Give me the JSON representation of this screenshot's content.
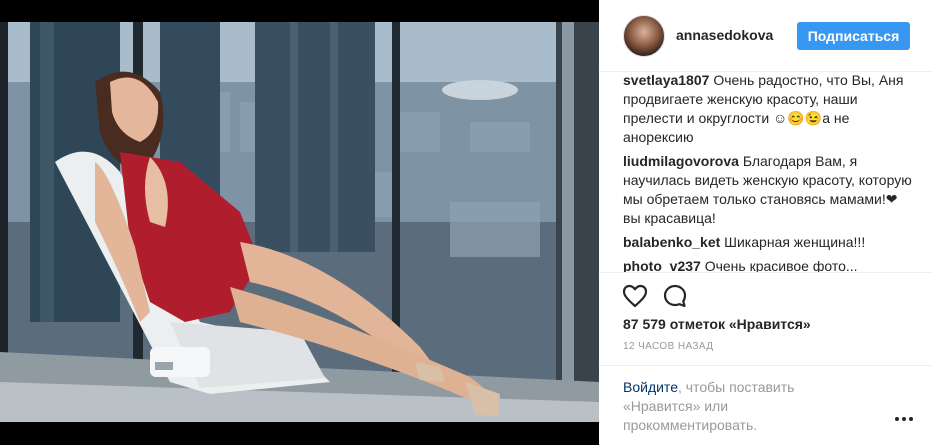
{
  "post": {
    "username": "annasedokova",
    "follow_label": "Подписаться",
    "likes_text": "87 579 отметок «Нравится»",
    "time_text": "12 ЧАСОВ НАЗАД"
  },
  "comments": [
    {
      "user": "svetlaya1807",
      "text": "Очень радостно, что Вы, Аня продвигаете женскую красоту, наши прелести и округлости ☺😊😉а не анорексию"
    },
    {
      "user": "liudmilagovorova",
      "text": "Благодаря Вам, я научилась видеть женскую красоту, которую мы обретаем только становясь мамами!❤ вы красавица!"
    },
    {
      "user": "balabenko_ket",
      "text": "Шикарная женщина!!!"
    },
    {
      "user": "photo_v237",
      "text": "Очень красивое фото..."
    }
  ],
  "login": {
    "link_text": "Войдите",
    "rest_text": ", чтобы поставить «Нравится» или прокомментировать."
  },
  "icons": {
    "like": "heart-outline-icon",
    "comment": "speech-bubble-icon",
    "more": "ellipsis-icon"
  },
  "colors": {
    "accent": "#3897f0",
    "link": "#003569",
    "muted": "#999999",
    "dress": "#b01e2e"
  }
}
